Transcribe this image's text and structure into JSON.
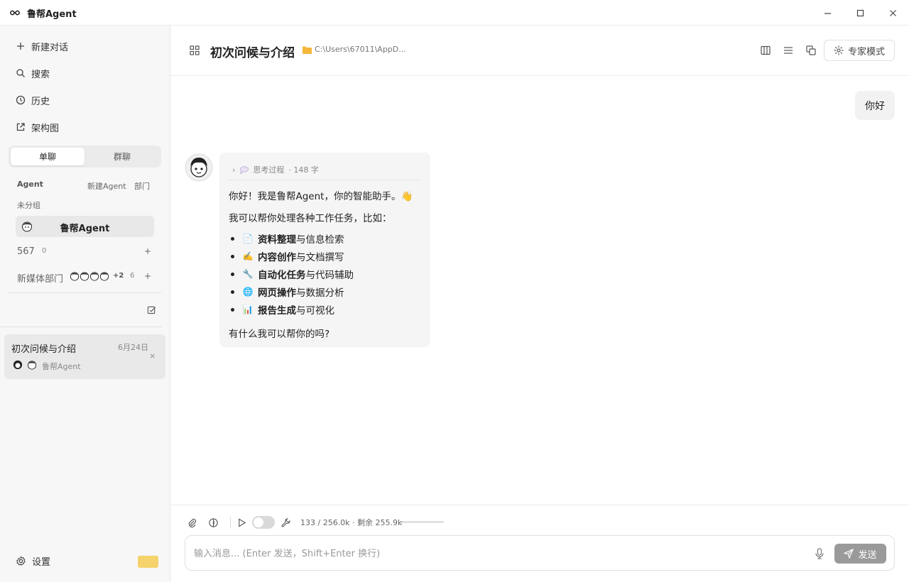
{
  "app": {
    "title": "鲁帮Agent"
  },
  "sidebar": {
    "nav": [
      {
        "label": "新建对话",
        "icon": "plus-icon"
      },
      {
        "label": "搜索",
        "icon": "search-icon"
      },
      {
        "label": "历史",
        "icon": "clock-icon"
      },
      {
        "label": "架构图",
        "icon": "external-link-icon"
      }
    ],
    "tabs": {
      "single": "单聊",
      "group": "群聊",
      "active": "single"
    },
    "agent_section": {
      "label": "Agent",
      "new_agent": "新建Agent",
      "department": "部门"
    },
    "ungrouped_label": "未分组",
    "active_agent": "鲁帮Agent",
    "groups": [
      {
        "name": "567",
        "count": "0"
      },
      {
        "name": "新媒体部门",
        "extra": "+2",
        "count": "6"
      }
    ],
    "plus": "+",
    "conversation": {
      "title": "初次问候与介绍",
      "date": "6月24日",
      "agent": "鲁帮Agent",
      "close": "×"
    },
    "settings_label": "设置"
  },
  "header": {
    "title": "初次问候与介绍",
    "path": "C:\\Users\\67011\\AppD...",
    "expert_mode": "专家模式"
  },
  "chat": {
    "user_message": "你好",
    "thinking": {
      "chevron": "›",
      "label": "思考过程",
      "chars": "· 148 字"
    },
    "greeting": "你好！我是鲁帮Agent，你的智能助手。👋",
    "intro": "我可以帮你处理各种工作任务，比如：",
    "bullets": [
      {
        "emoji": "📄",
        "bold": "资料整理",
        "rest": "与信息检索"
      },
      {
        "emoji": "✍️",
        "bold": "内容创作",
        "rest": "与文档撰写"
      },
      {
        "emoji": "🔧",
        "bold": "自动化任务",
        "rest": "与代码辅助"
      },
      {
        "emoji": "🌐",
        "bold": "网页操作",
        "rest": "与数据分析"
      },
      {
        "emoji": "📊",
        "bold": "报告生成",
        "rest": "与可视化"
      }
    ],
    "closing": "有什么我可以帮你的吗?"
  },
  "input": {
    "token_info": "133 /  256.0k  · 剩余 255.9k",
    "token_used_fraction": 0.0005,
    "placeholder": "输入消息... (Enter 发送，Shift+Enter 换行)",
    "send_label": "发送"
  }
}
